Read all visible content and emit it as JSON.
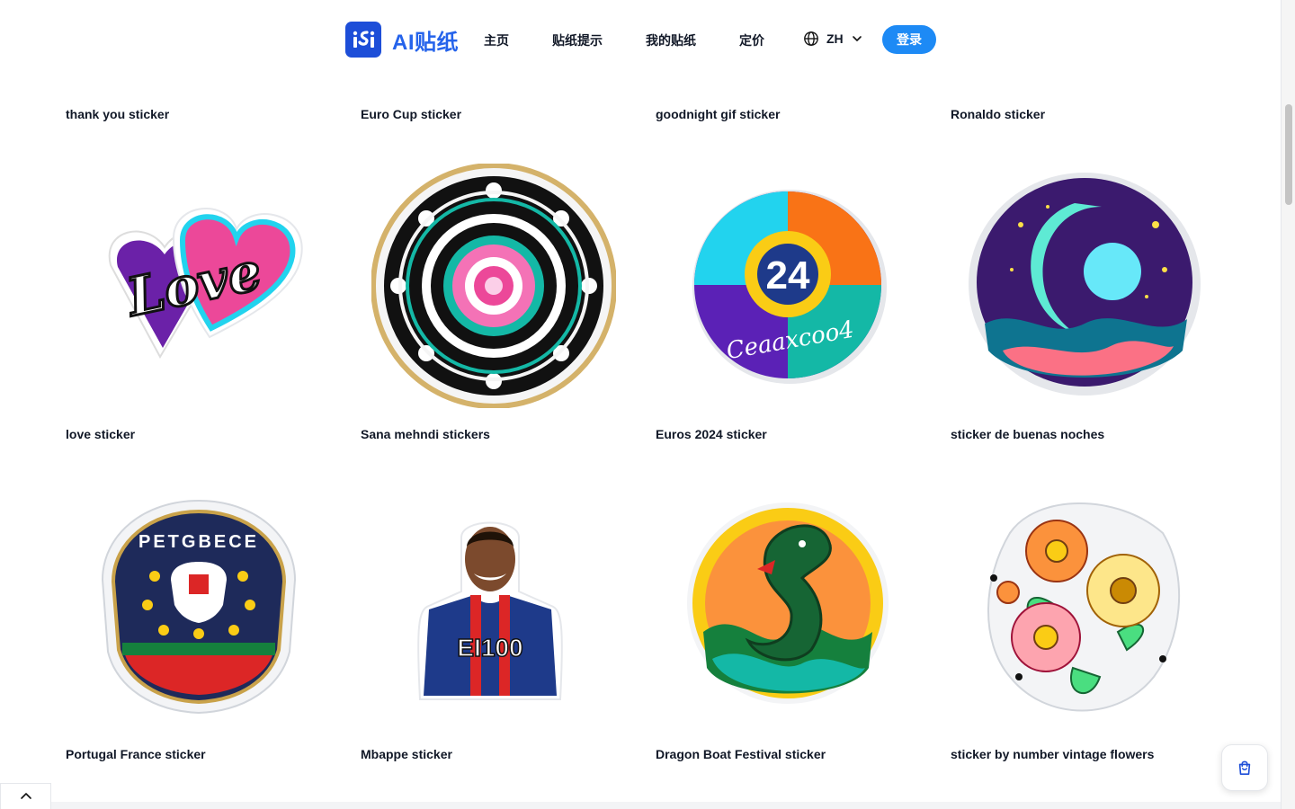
{
  "header": {
    "brand": "AI贴纸",
    "nav": [
      {
        "label": "主页"
      },
      {
        "label": "贴纸提示"
      },
      {
        "label": "我的贴纸"
      },
      {
        "label": "定价"
      }
    ],
    "language": "ZH",
    "login_label": "登录"
  },
  "stickers": [
    {
      "caption": "thank you sticker"
    },
    {
      "caption": "Euro Cup sticker"
    },
    {
      "caption": "goodnight gif sticker"
    },
    {
      "caption": "Ronaldo sticker"
    },
    {
      "caption": "love sticker",
      "art_text": "Love"
    },
    {
      "caption": "Sana mehndi stickers"
    },
    {
      "caption": "Euros 2024 sticker",
      "art_text": "24",
      "art_subtext": "Ceaaxcoo4"
    },
    {
      "caption": "sticker de buenas noches"
    },
    {
      "caption": "Portugal France sticker",
      "art_text": "PETGBECE"
    },
    {
      "caption": "Mbappe sticker",
      "art_text": "EI100"
    },
    {
      "caption": "Dragon Boat Festival sticker"
    },
    {
      "caption": "sticker by number vintage flowers"
    }
  ],
  "colors": {
    "brand": "#2563eb",
    "login_bg": "#1d8af5"
  }
}
